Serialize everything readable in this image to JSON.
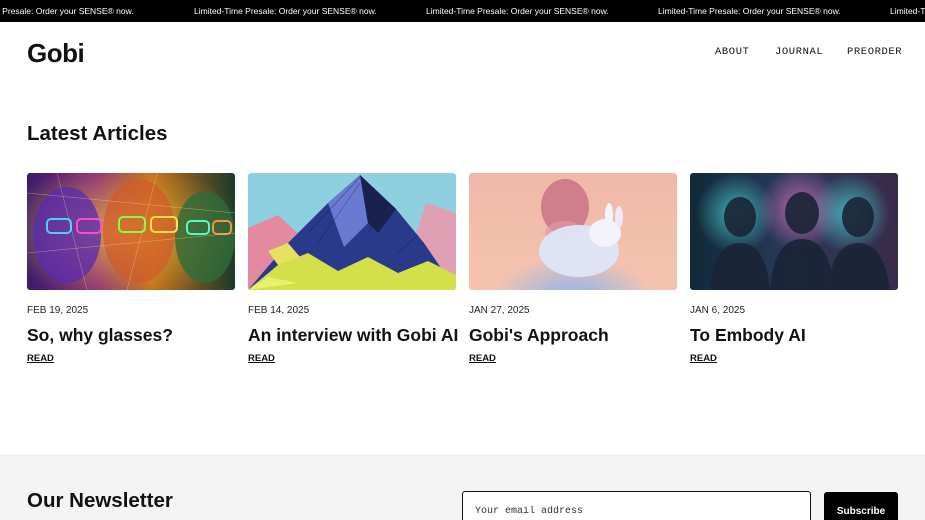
{
  "banner": {
    "items": [
      "me Presale: Order your SENSE® now.",
      "Limited-Time Presale: Order your SENSE® now.",
      "Limited-Time Presale: Order your SENSE® now.",
      "Limited-Time Presale: Order your SENSE® now.",
      "Limited-Ti"
    ]
  },
  "header": {
    "logo": "Gobi",
    "nav": [
      "ABOUT",
      "JOURNAL",
      "PREORDER"
    ]
  },
  "articles": {
    "heading": "Latest Articles",
    "items": [
      {
        "date": "FEB 19, 2025",
        "title": "So, why glasses?",
        "link": "READ",
        "image": "neon-glasses-faces-image"
      },
      {
        "date": "FEB 14, 2025",
        "title": "An interview with Gobi AI",
        "link": "READ",
        "image": "mountain-illustration-image"
      },
      {
        "date": "JAN 27, 2025",
        "title": "Gobi's Approach",
        "link": "READ",
        "image": "person-with-rabbit-image"
      },
      {
        "date": "JAN 6, 2025",
        "title": "To Embody AI",
        "link": "READ",
        "image": "glowing-silhouettes-image"
      }
    ]
  },
  "newsletter": {
    "heading": "Our Newsletter",
    "email_placeholder": "Your email address",
    "subscribe_label": "Subscribe"
  },
  "colors": {
    "background": "#ffffff",
    "banner_bg": "#000000",
    "text": "#111111",
    "newsletter_bg": "#f4f4f4",
    "button_bg": "#000000"
  }
}
